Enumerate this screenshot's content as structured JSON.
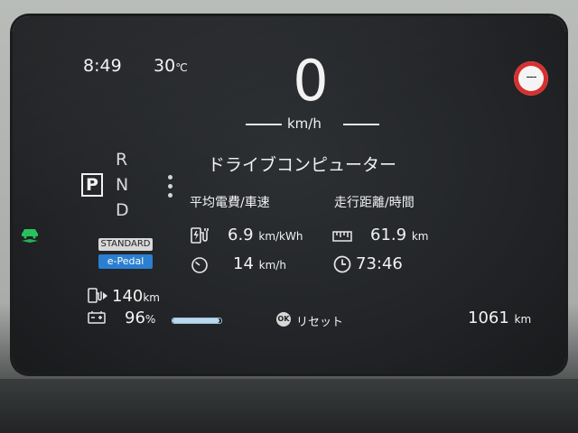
{
  "status": {
    "time": "8:49",
    "temperature": "30",
    "temperature_unit": "℃"
  },
  "speedometer": {
    "value": "0",
    "unit": "km/h"
  },
  "speed_limit_sign": {
    "text": "---"
  },
  "gear": {
    "current": "P",
    "options": [
      "R",
      "N",
      "D"
    ]
  },
  "drive_mode": {
    "mode": "STANDARD",
    "pedal": "e-Pedal"
  },
  "drive_computer": {
    "title": "ドライブコンピューター",
    "left_header": "平均電費/車速",
    "right_header": "走行距離/時間",
    "efficiency": "6.9",
    "efficiency_unit": "km/kWh",
    "avg_speed": "14",
    "avg_speed_unit": "km/h",
    "distance": "61.9",
    "distance_unit": "km",
    "time": "73:46"
  },
  "battery": {
    "range": "140",
    "range_unit": "km",
    "charge": "96",
    "charge_unit": "%",
    "charge_fraction": 0.96
  },
  "reset": {
    "ok_label": "OK",
    "label": "リセット"
  },
  "odometer": {
    "value": "1061",
    "unit": "km"
  },
  "colors": {
    "speed_limit_ring": "#d8302f",
    "e_pedal": "#2b7fd0",
    "driving_assist_icon": "#27c25e"
  },
  "icons": [
    "ev-charge-icon",
    "stopwatch-icon",
    "ruler-icon",
    "clock-icon",
    "battery-icon",
    "car-assist-icon"
  ]
}
